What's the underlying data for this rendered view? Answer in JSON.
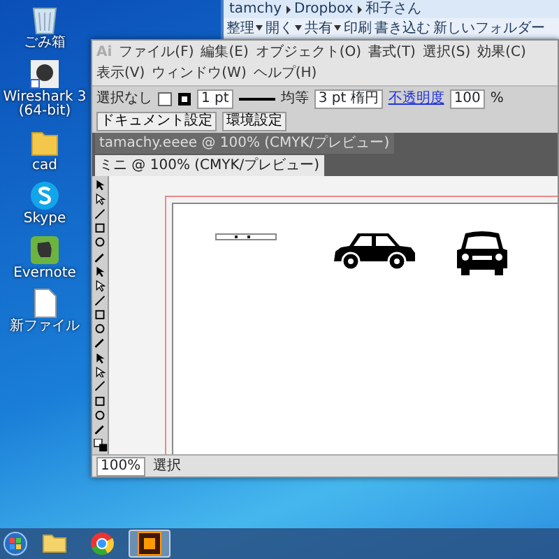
{
  "desktop_icons": [
    {
      "label": "ごみ箱",
      "kind": "trash"
    },
    {
      "label": "Wireshark 3 (64-bit)",
      "kind": "app"
    },
    {
      "label": "cad",
      "kind": "folder"
    },
    {
      "label": "Skype",
      "kind": "skype"
    },
    {
      "label": "Evernote",
      "kind": "evernote"
    },
    {
      "label": "新ファイル",
      "kind": "file"
    }
  ],
  "explorer": {
    "breadcrumb": [
      "tamchy",
      "Dropbox",
      "和子さん"
    ],
    "toolbar": [
      {
        "label": "整理",
        "dropdown": true
      },
      {
        "label": "開く",
        "dropdown": true
      },
      {
        "label": "共有",
        "dropdown": true
      },
      {
        "label": "印刷",
        "dropdown": false
      },
      {
        "label": "書き込む",
        "dropdown": false
      },
      {
        "label": "新しいフォルダー",
        "dropdown": false
      }
    ]
  },
  "illustrator": {
    "logo": "Ai",
    "menu": [
      "ファイル(F)",
      "編集(E)",
      "オブジェクト(O)",
      "書式(T)",
      "選択(S)",
      "効果(C)",
      "表示(V)",
      "ウィンドウ(W)",
      "ヘルプ(H)"
    ],
    "control_bar": {
      "selection": "選択なし",
      "stroke_weight": "1 pt",
      "brush": "均等",
      "profile": "3 pt 楕円",
      "opacity_label": "不透明度",
      "opacity": "100",
      "percent": "%",
      "buttons": [
        "ドキュメント設定",
        "環境設定"
      ]
    },
    "tabs": [
      {
        "label": "tamachy.eeee @ 100% (CMYK/プレビュー)",
        "selected": false
      },
      {
        "label": "ミニ @ 100% (CMYK/プレビュー)",
        "selected": true
      }
    ],
    "status": {
      "zoom": "100%",
      "mode": "選択"
    }
  },
  "taskbar": [
    {
      "kind": "explorer",
      "selected": false
    },
    {
      "kind": "chrome",
      "selected": false
    },
    {
      "kind": "illustrator",
      "selected": true
    }
  ]
}
